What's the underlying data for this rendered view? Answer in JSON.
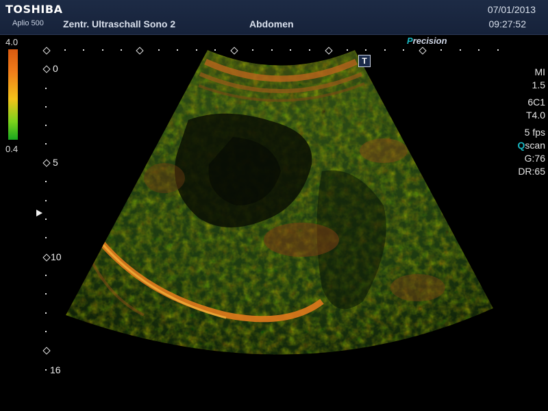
{
  "header": {
    "brand": "TOSHIBA",
    "model": "Aplio 500",
    "institution": "Zentr. Ultraschall Sono 2",
    "exam": "Abdomen",
    "date": "07/01/2013",
    "time": "09:27:52"
  },
  "color_scale": {
    "max": "4.0",
    "min": "0.4",
    "colors": [
      "#d95a10",
      "#f07d1a",
      "#f2c21a",
      "#7bd21c",
      "#18a81e"
    ]
  },
  "depth_scale": {
    "labels": [
      "0",
      "5",
      "10",
      "16"
    ]
  },
  "overlay": {
    "precision_prefix": "P",
    "precision_rest": "recision",
    "t_badge": "T"
  },
  "params": {
    "mi_label": "MI",
    "mi_value": "1.5",
    "probe": "6C1",
    "tis": "T4.0",
    "fps": "5 fps",
    "qscan_q": "Q",
    "qscan_rest": "scan",
    "gain": "G:76",
    "dynamic_range": "DR:65"
  }
}
